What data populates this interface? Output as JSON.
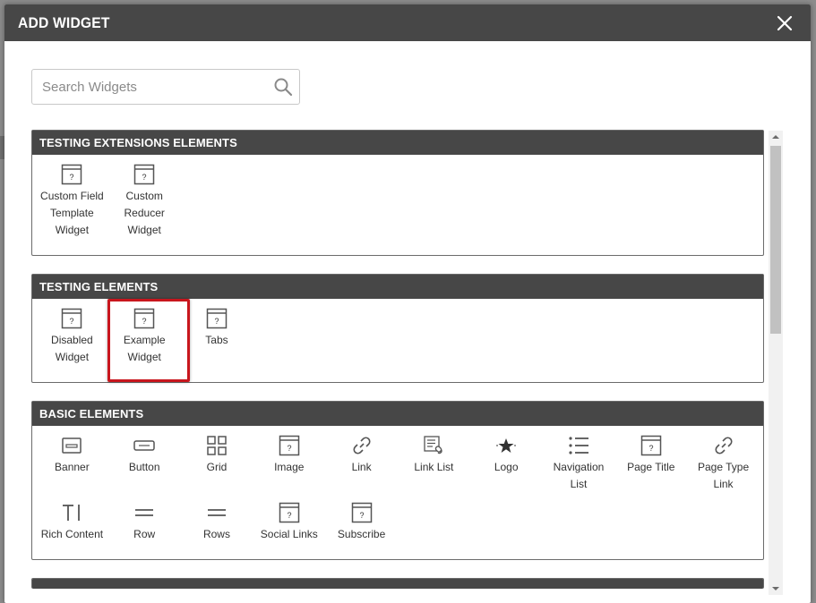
{
  "modal": {
    "title": "ADD WIDGET",
    "close_icon": "close-icon"
  },
  "search": {
    "placeholder": "Search Widgets",
    "value": "",
    "icon": "search-icon"
  },
  "sections": [
    {
      "title": "TESTING EXTENSIONS ELEMENTS",
      "widgets": [
        {
          "label": "Custom Field Template Widget",
          "icon": "unknown-widget-icon"
        },
        {
          "label": "Custom Reducer Widget",
          "icon": "unknown-widget-icon"
        }
      ]
    },
    {
      "title": "TESTING ELEMENTS",
      "widgets": [
        {
          "label": "Disabled Widget",
          "icon": "unknown-widget-icon"
        },
        {
          "label": "Example Widget",
          "icon": "unknown-widget-icon",
          "highlighted": true
        },
        {
          "label": "Tabs",
          "icon": "unknown-widget-icon"
        }
      ]
    },
    {
      "title": "BASIC ELEMENTS",
      "widgets": [
        {
          "label": "Banner",
          "icon": "banner-icon"
        },
        {
          "label": "Button",
          "icon": "button-icon"
        },
        {
          "label": "Grid",
          "icon": "grid-icon"
        },
        {
          "label": "Image",
          "icon": "unknown-widget-icon"
        },
        {
          "label": "Link",
          "icon": "link-icon"
        },
        {
          "label": "Link List",
          "icon": "link-list-icon"
        },
        {
          "label": "Logo",
          "icon": "logo-star-icon"
        },
        {
          "label": "Navigation List",
          "icon": "navigation-list-icon"
        },
        {
          "label": "Page Title",
          "icon": "unknown-widget-icon"
        },
        {
          "label": "Page Type Link",
          "icon": "link-icon"
        },
        {
          "label": "Rich Content",
          "icon": "rich-content-icon"
        },
        {
          "label": "Row",
          "icon": "row-icon"
        },
        {
          "label": "Rows",
          "icon": "rows-icon"
        },
        {
          "label": "Social Links",
          "icon": "unknown-widget-icon"
        },
        {
          "label": "Subscribe",
          "icon": "unknown-widget-icon"
        }
      ]
    }
  ],
  "colors": {
    "header_bg": "#474747",
    "highlight": "#c8161d"
  }
}
